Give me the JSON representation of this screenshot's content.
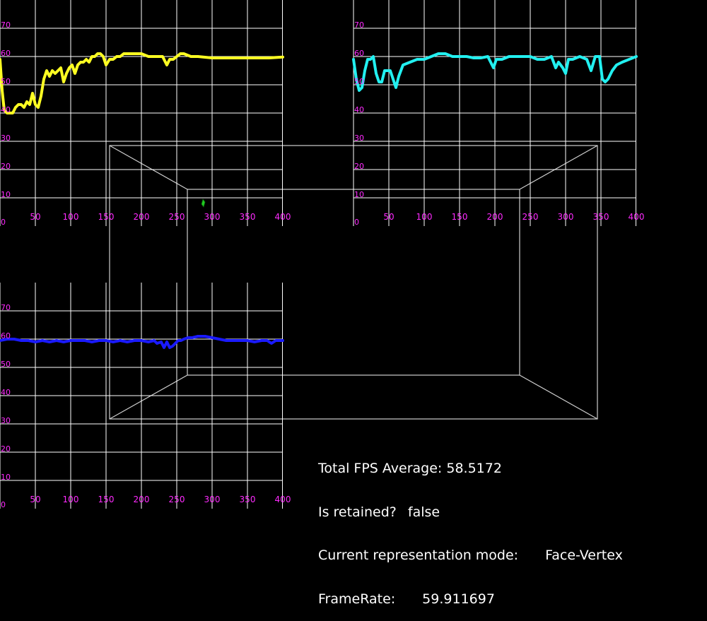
{
  "colors": {
    "background": "#000000",
    "grid": "#ffffff",
    "tick_label": "#ff2bff",
    "box": "#cfcfcf",
    "cursor": "#22cc22"
  },
  "stats": {
    "fps_label": "Total FPS Average:",
    "fps_value": "58.5172",
    "retained_label": "Is retained?",
    "retained_value": "false",
    "mode_label": "Current representation mode:",
    "mode_value": "Face-Vertex",
    "framerate_label": "FrameRate:",
    "framerate_value": "59.911697"
  },
  "chart_data": [
    {
      "type": "line",
      "color": "#ffff22",
      "xlim": [
        0,
        400
      ],
      "ylim": [
        0,
        80
      ],
      "x_ticks": [
        "50",
        "100",
        "150",
        "200",
        "250",
        "300",
        "350",
        "400"
      ],
      "y_ticks": [
        "0",
        "10",
        "20",
        "30",
        "40",
        "50",
        "60",
        "70"
      ],
      "grid": true,
      "x": [
        0,
        3,
        6,
        10,
        14,
        18,
        22,
        26,
        30,
        34,
        38,
        42,
        46,
        50,
        54,
        58,
        62,
        66,
        70,
        74,
        78,
        82,
        86,
        90,
        94,
        98,
        102,
        106,
        110,
        114,
        118,
        122,
        126,
        130,
        134,
        138,
        142,
        146,
        150,
        155,
        160,
        165,
        170,
        175,
        180,
        185,
        190,
        195,
        200,
        210,
        220,
        230,
        236,
        240,
        245,
        250,
        255,
        260,
        270,
        280,
        300,
        320,
        340,
        360,
        380,
        400
      ],
      "y": [
        59,
        48,
        41,
        40,
        40,
        40,
        42,
        43,
        43,
        42,
        44,
        43,
        47,
        43,
        42,
        46,
        52,
        55,
        53,
        55,
        54,
        55,
        56,
        51,
        54,
        56,
        57,
        54,
        57,
        58,
        58,
        59,
        58,
        60,
        60,
        61,
        61,
        60,
        57,
        59,
        59,
        60,
        60,
        61,
        61,
        61,
        61,
        61,
        61,
        60,
        60,
        60,
        57,
        59,
        59,
        60,
        61,
        61,
        60,
        60,
        59.5,
        59.5,
        59.5,
        59.5,
        59.5,
        59.8
      ]
    },
    {
      "type": "line",
      "color": "#22f0f0",
      "xlim": [
        0,
        400
      ],
      "ylim": [
        0,
        80
      ],
      "x_ticks": [
        "50",
        "100",
        "150",
        "200",
        "250",
        "300",
        "350",
        "400"
      ],
      "y_ticks": [
        "0",
        "10",
        "20",
        "30",
        "40",
        "50",
        "60",
        "70"
      ],
      "grid": true,
      "x": [
        0,
        4,
        8,
        12,
        16,
        20,
        24,
        28,
        32,
        36,
        40,
        44,
        48,
        52,
        56,
        60,
        64,
        70,
        80,
        90,
        100,
        110,
        120,
        130,
        140,
        150,
        160,
        170,
        180,
        190,
        198,
        202,
        210,
        220,
        240,
        250,
        260,
        270,
        280,
        286,
        290,
        296,
        300,
        304,
        310,
        320,
        330,
        336,
        342,
        348,
        352,
        356,
        360,
        366,
        372,
        380,
        390,
        400
      ],
      "y": [
        59,
        52,
        48,
        49,
        55,
        59,
        59,
        60,
        54,
        51,
        51,
        55,
        55,
        55,
        52,
        49,
        53,
        57,
        58,
        59,
        59,
        60,
        61,
        61,
        60,
        60,
        60,
        59.5,
        59.5,
        60,
        56,
        59,
        59,
        60,
        60,
        60,
        59,
        59,
        60,
        56,
        58,
        56,
        54,
        59,
        59,
        60,
        59,
        55,
        60,
        60,
        52,
        51,
        52,
        55,
        57,
        58,
        59,
        60
      ]
    },
    {
      "type": "line",
      "color": "#1a1aff",
      "xlim": [
        0,
        400
      ],
      "ylim": [
        0,
        80
      ],
      "x_ticks": [
        "50",
        "100",
        "150",
        "200",
        "250",
        "300",
        "350",
        "400"
      ],
      "y_ticks": [
        "0",
        "10",
        "20",
        "30",
        "40",
        "50",
        "60",
        "70"
      ],
      "grid": true,
      "x": [
        0,
        10,
        20,
        30,
        40,
        50,
        60,
        70,
        80,
        90,
        100,
        110,
        120,
        130,
        140,
        150,
        160,
        170,
        180,
        190,
        200,
        210,
        218,
        222,
        228,
        232,
        236,
        240,
        244,
        248,
        252,
        256,
        260,
        266,
        272,
        280,
        290,
        300,
        310,
        320,
        330,
        340,
        350,
        360,
        370,
        378,
        384,
        390,
        400
      ],
      "y": [
        59.5,
        60,
        60,
        59.5,
        59.5,
        59,
        59.5,
        59,
        59.5,
        59,
        59.5,
        59.5,
        59.5,
        59,
        59.5,
        59.5,
        59,
        59.5,
        59,
        59.5,
        59.5,
        59,
        59.5,
        58.5,
        59,
        57,
        59,
        57,
        57.5,
        58.5,
        59.5,
        59.5,
        60,
        60.5,
        60.5,
        61,
        61,
        60.5,
        60,
        59.5,
        59.5,
        59.5,
        59.5,
        59,
        59.5,
        59.5,
        58.5,
        59.5,
        59.5
      ]
    }
  ]
}
